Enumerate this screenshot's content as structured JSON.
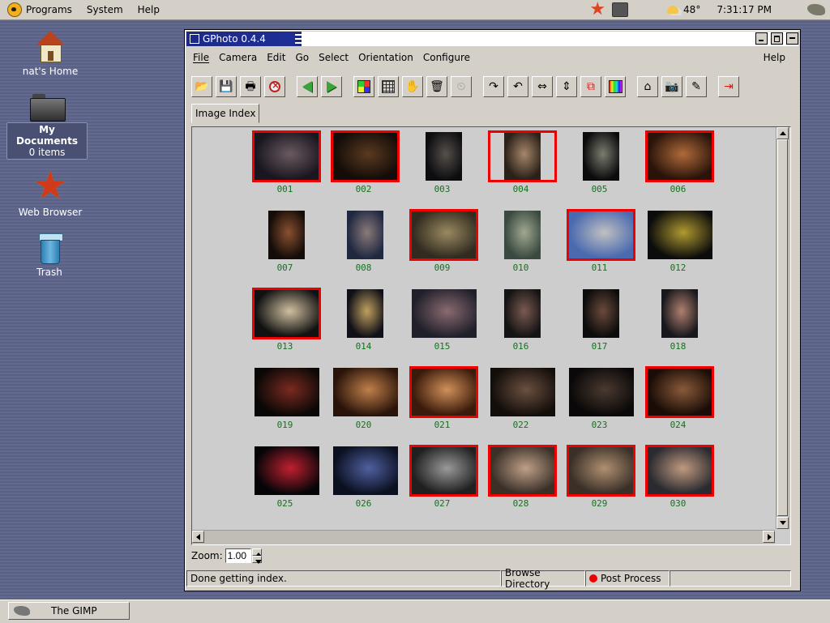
{
  "panel": {
    "menus": [
      "Programs",
      "System",
      "Help"
    ],
    "weather_temp": "48°",
    "clock": "7:31:17 PM"
  },
  "desktop": {
    "icons": [
      {
        "label": "nat's Home"
      },
      {
        "label": "My Documents",
        "sub": "0 items"
      },
      {
        "label": "Web Browser"
      },
      {
        "label": "Trash"
      }
    ]
  },
  "window": {
    "title": "GPhoto 0.4.4",
    "menus": [
      "File",
      "Camera",
      "Edit",
      "Go",
      "Select",
      "Orientation",
      "Configure"
    ],
    "help_menu": "Help",
    "tab": "Image Index",
    "thumbnails": [
      {
        "num": "001",
        "selected": true,
        "img": [
          80,
          64
        ],
        "colors": [
          "#1a1620",
          "#6a5a60"
        ]
      },
      {
        "num": "002",
        "selected": true,
        "img": [
          80,
          64
        ],
        "colors": [
          "#130c08",
          "#5a3a20"
        ]
      },
      {
        "num": "003",
        "selected": false,
        "img": [
          45,
          60
        ],
        "colors": [
          "#0d0d10",
          "#55504a"
        ]
      },
      {
        "num": "004",
        "selected": true,
        "img": [
          45,
          60
        ],
        "colors": [
          "#2a2118",
          "#a6866a"
        ]
      },
      {
        "num": "005",
        "selected": false,
        "img": [
          45,
          60
        ],
        "colors": [
          "#0b0b0b",
          "#7a7c70"
        ]
      },
      {
        "num": "006",
        "selected": true,
        "img": [
          80,
          64
        ],
        "colors": [
          "#2a140a",
          "#b06a3a"
        ]
      },
      {
        "num": "007",
        "selected": false,
        "img": [
          45,
          60
        ],
        "colors": [
          "#140c08",
          "#8a5030"
        ]
      },
      {
        "num": "008",
        "selected": false,
        "img": [
          45,
          60
        ],
        "colors": [
          "#202840",
          "#8a7a7a"
        ]
      },
      {
        "num": "009",
        "selected": true,
        "img": [
          80,
          64
        ],
        "colors": [
          "#302a20",
          "#9a8a60"
        ]
      },
      {
        "num": "010",
        "selected": false,
        "img": [
          45,
          60
        ],
        "colors": [
          "#3a4a40",
          "#a0a890"
        ]
      },
      {
        "num": "011",
        "selected": true,
        "img": [
          80,
          64
        ],
        "colors": [
          "#4a6ab0",
          "#c0c0c0"
        ]
      },
      {
        "num": "012",
        "selected": false,
        "img": [
          80,
          60
        ],
        "colors": [
          "#0c0c0c",
          "#b09a30"
        ]
      },
      {
        "num": "013",
        "selected": true,
        "img": [
          80,
          64
        ],
        "colors": [
          "#111111",
          "#d0c0a0"
        ]
      },
      {
        "num": "014",
        "selected": false,
        "img": [
          45,
          60
        ],
        "colors": [
          "#101018",
          "#c0a060"
        ]
      },
      {
        "num": "015",
        "selected": false,
        "img": [
          80,
          60
        ],
        "colors": [
          "#20202a",
          "#8a6a70"
        ]
      },
      {
        "num": "016",
        "selected": false,
        "img": [
          45,
          60
        ],
        "colors": [
          "#141414",
          "#7a5a50"
        ]
      },
      {
        "num": "017",
        "selected": false,
        "img": [
          45,
          60
        ],
        "colors": [
          "#0c0c0c",
          "#6a4a3a"
        ]
      },
      {
        "num": "018",
        "selected": false,
        "img": [
          45,
          60
        ],
        "colors": [
          "#18181c",
          "#b08070"
        ]
      },
      {
        "num": "019",
        "selected": false,
        "img": [
          80,
          60
        ],
        "colors": [
          "#0a0806",
          "#7a2a20"
        ]
      },
      {
        "num": "020",
        "selected": false,
        "img": [
          80,
          60
        ],
        "colors": [
          "#2a140a",
          "#c0804a"
        ]
      },
      {
        "num": "021",
        "selected": true,
        "img": [
          80,
          64
        ],
        "colors": [
          "#3a1a0a",
          "#d0905a"
        ]
      },
      {
        "num": "022",
        "selected": false,
        "img": [
          80,
          60
        ],
        "colors": [
          "#140e0a",
          "#6a5040"
        ]
      },
      {
        "num": "023",
        "selected": false,
        "img": [
          80,
          60
        ],
        "colors": [
          "#0a0808",
          "#4a3a30"
        ]
      },
      {
        "num": "024",
        "selected": true,
        "img": [
          80,
          64
        ],
        "colors": [
          "#1a0c06",
          "#8a5a3a"
        ]
      },
      {
        "num": "025",
        "selected": false,
        "img": [
          80,
          60
        ],
        "colors": [
          "#050508",
          "#c02030"
        ]
      },
      {
        "num": "026",
        "selected": false,
        "img": [
          80,
          60
        ],
        "colors": [
          "#0a1020",
          "#5060a0"
        ]
      },
      {
        "num": "027",
        "selected": true,
        "img": [
          80,
          64
        ],
        "colors": [
          "#202020",
          "#9a9a9a"
        ]
      },
      {
        "num": "028",
        "selected": true,
        "img": [
          80,
          64
        ],
        "colors": [
          "#3a3028",
          "#c0a088"
        ]
      },
      {
        "num": "029",
        "selected": true,
        "img": [
          80,
          64
        ],
        "colors": [
          "#3a3028",
          "#b09070"
        ]
      },
      {
        "num": "030",
        "selected": true,
        "img": [
          80,
          64
        ],
        "colors": [
          "#2a2a30",
          "#c09a80"
        ]
      }
    ],
    "zoom_label": "Zoom:",
    "zoom_value": "1.00",
    "status_text": "Done getting index.",
    "browse_directory": "Browse Directory",
    "post_process": "Post Process"
  },
  "taskbar": {
    "task_label": "The GIMP"
  },
  "colors": {
    "selected_border": "#e00000",
    "thumb_number": "#15711f",
    "titlebar": "#1c2a86"
  }
}
